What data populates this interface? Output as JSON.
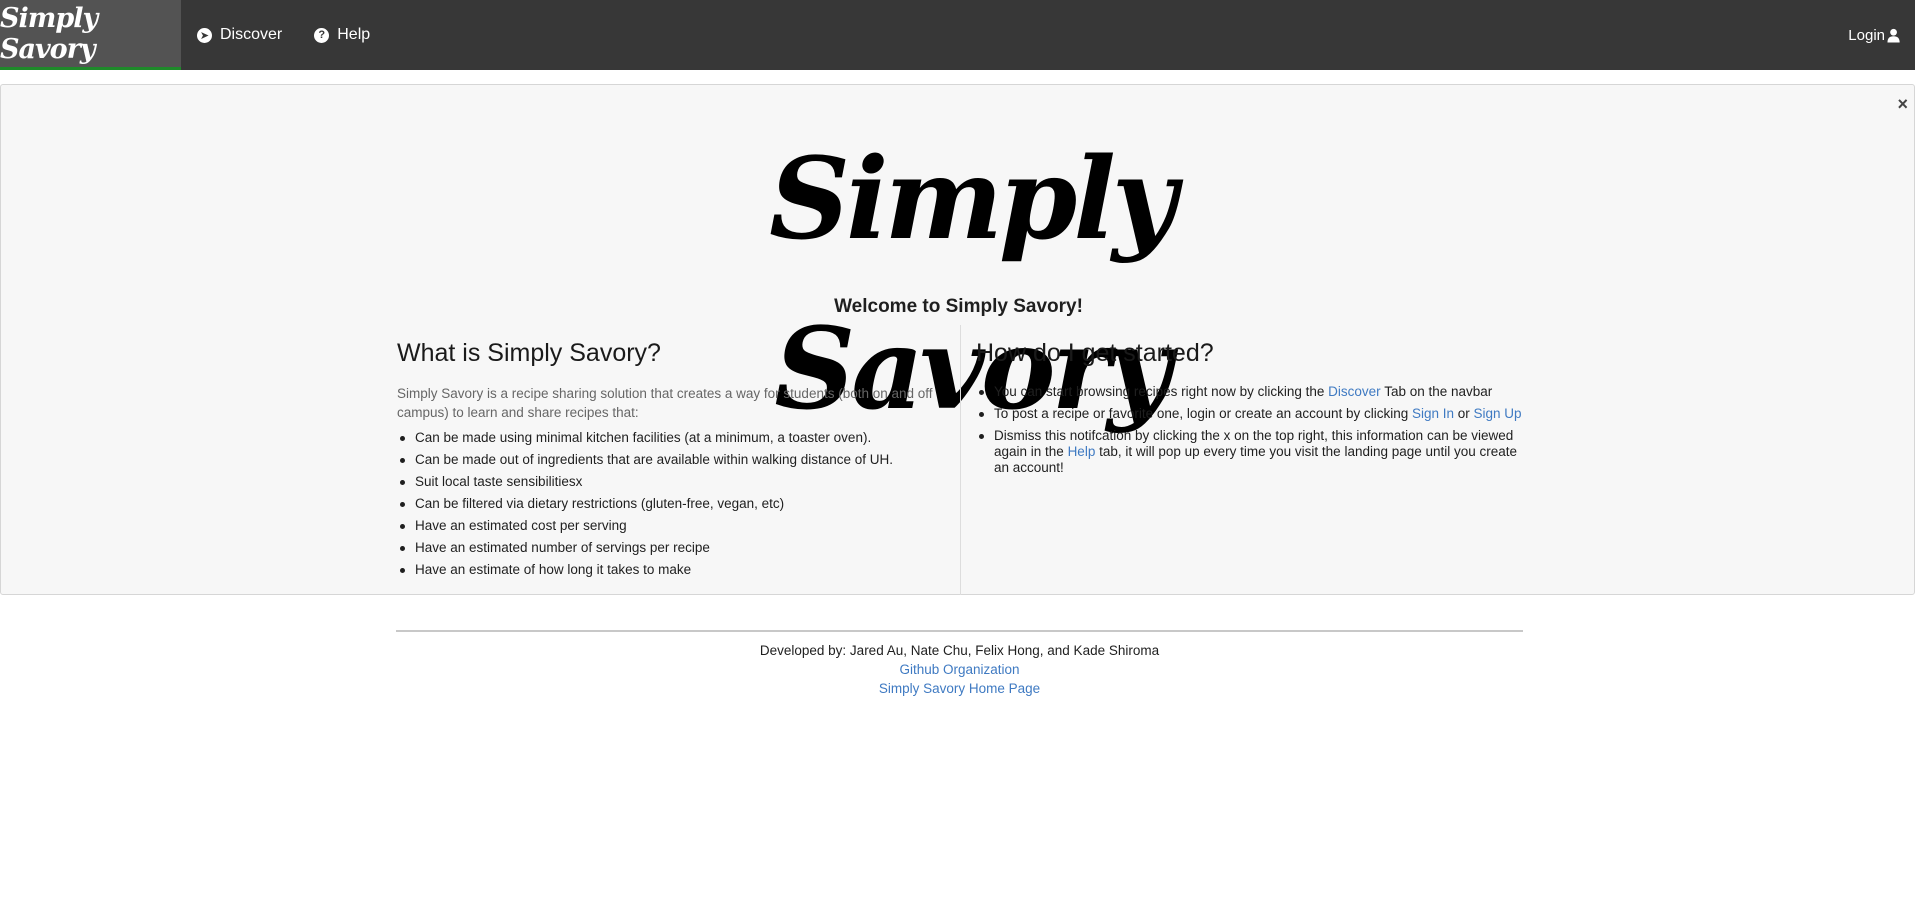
{
  "navbar": {
    "brand": "Simply Savory",
    "items": [
      {
        "label": "Discover",
        "icon": "compass-icon"
      },
      {
        "label": "Help",
        "icon": "question-circle-icon"
      }
    ],
    "login_label": "Login",
    "colors": {
      "background": "#373737",
      "brand_bg": "#535353",
      "active_underline": "#1e8a2a"
    }
  },
  "notification": {
    "close_glyph": "×",
    "logo_text": "Simply Savory",
    "welcome": "Welcome to Simply Savory!",
    "left": {
      "heading": "What is Simply Savory?",
      "intro": "Simply Savory is a recipe sharing solution that creates a way for students (both on and off campus) to learn and share recipes that:",
      "bullets": [
        "Can be made using minimal kitchen facilities (at a minimum, a toaster oven).",
        "Can be made out of ingredients that are available within walking distance of UH.",
        "Suit local taste sensibilitiesx",
        "Can be filtered via dietary restrictions (gluten-free, vegan, etc)",
        "Have an estimated cost per serving",
        "Have an estimated number of servings per recipe",
        "Have an estimate of how long it takes to make"
      ]
    },
    "right": {
      "heading": "How do I get started?",
      "b1": {
        "pre": "You can start browsing recipes right now by clicking the ",
        "link": "Discover",
        "post": " Tab on the navbar"
      },
      "b2": {
        "pre": "To post a recipe or favorite one, login or create an account by clicking ",
        "link1": "Sign In",
        "mid": " or ",
        "link2": "Sign Up"
      },
      "b3": {
        "pre": "Dismiss this notifcation by clicking the x on the top right, this information can be viewed again in the ",
        "link": "Help",
        "post": " tab, it will pop up every time you visit the landing page until you create an account!"
      }
    }
  },
  "footer": {
    "developers": "Developed by: Jared Au, Nate Chu, Felix Hong, and Kade Shiroma",
    "github_link": "Github Organization",
    "home_link": "Simply Savory Home Page"
  }
}
